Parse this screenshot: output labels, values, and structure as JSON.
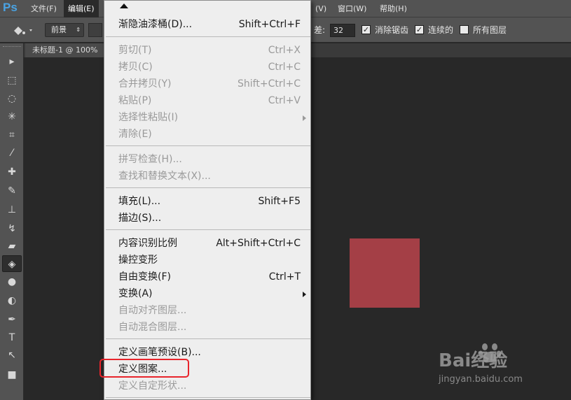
{
  "app": {
    "logo": "Ps"
  },
  "menubar": {
    "items": [
      {
        "label": "文件(F)"
      },
      {
        "label": "编辑(E)"
      },
      {
        "label": "(V)"
      },
      {
        "label": "窗口(W)"
      },
      {
        "label": "帮助(H)"
      }
    ],
    "active_index": 1
  },
  "options": {
    "fill_source": "前景",
    "tolerance_label": "差:",
    "tolerance_value": "32",
    "antialias_label": "消除锯齿",
    "antialias_checked": true,
    "contiguous_label": "连续的",
    "contiguous_checked": true,
    "all_layers_label": "所有图层",
    "all_layers_checked": false
  },
  "toolbox": {
    "tools": [
      {
        "name": "move-tool-icon",
        "glyph": "▸"
      },
      {
        "name": "marquee-tool-icon",
        "glyph": "⬚"
      },
      {
        "name": "lasso-tool-icon",
        "glyph": "◌"
      },
      {
        "name": "magic-wand-tool-icon",
        "glyph": "✳"
      },
      {
        "name": "crop-tool-icon",
        "glyph": "⌗"
      },
      {
        "name": "eyedropper-tool-icon",
        "glyph": "⁄"
      },
      {
        "name": "healing-brush-tool-icon",
        "glyph": "✚"
      },
      {
        "name": "brush-tool-icon",
        "glyph": "✎"
      },
      {
        "name": "stamp-tool-icon",
        "glyph": "⊥"
      },
      {
        "name": "history-brush-tool-icon",
        "glyph": "↯"
      },
      {
        "name": "eraser-tool-icon",
        "glyph": "▰"
      },
      {
        "name": "paint-bucket-tool-icon",
        "glyph": "◈"
      },
      {
        "name": "blur-tool-icon",
        "glyph": "●"
      },
      {
        "name": "dodge-tool-icon",
        "glyph": "◐"
      },
      {
        "name": "pen-tool-icon",
        "glyph": "✒"
      },
      {
        "name": "type-tool-icon",
        "glyph": "T"
      },
      {
        "name": "path-select-tool-icon",
        "glyph": "↖"
      },
      {
        "name": "shape-tool-icon",
        "glyph": "■"
      }
    ],
    "selected_index": 11
  },
  "document": {
    "tab_title": "未标题-1 @ 100%"
  },
  "canvas": {
    "shape_color": "#a43f46"
  },
  "edit_menu": {
    "items": [
      {
        "label": "渐隐油漆桶(D)...",
        "shortcut": "Shift+Ctrl+F",
        "disabled": false
      },
      {
        "label": "剪切(T)",
        "shortcut": "Ctrl+X",
        "disabled": true
      },
      {
        "label": "拷贝(C)",
        "shortcut": "Ctrl+C",
        "disabled": true
      },
      {
        "label": "合并拷贝(Y)",
        "shortcut": "Shift+Ctrl+C",
        "disabled": true
      },
      {
        "label": "粘贴(P)",
        "shortcut": "Ctrl+V",
        "disabled": true
      },
      {
        "label": "选择性粘贴(I)",
        "shortcut": "",
        "disabled": true,
        "submenu": true
      },
      {
        "label": "清除(E)",
        "shortcut": "",
        "disabled": true
      },
      {
        "label": "拼写检查(H)...",
        "shortcut": "",
        "disabled": true
      },
      {
        "label": "查找和替换文本(X)...",
        "shortcut": "",
        "disabled": true
      },
      {
        "label": "填充(L)...",
        "shortcut": "Shift+F5",
        "disabled": false
      },
      {
        "label": "描边(S)...",
        "shortcut": "",
        "disabled": false
      },
      {
        "label": "内容识别比例",
        "shortcut": "Alt+Shift+Ctrl+C",
        "disabled": false
      },
      {
        "label": "操控变形",
        "shortcut": "",
        "disabled": false
      },
      {
        "label": "自由变换(F)",
        "shortcut": "Ctrl+T",
        "disabled": false
      },
      {
        "label": "变换(A)",
        "shortcut": "",
        "disabled": false,
        "submenu": true
      },
      {
        "label": "自动对齐图层...",
        "shortcut": "",
        "disabled": true
      },
      {
        "label": "自动混合图层...",
        "shortcut": "",
        "disabled": true
      },
      {
        "label": "定义画笔预设(B)...",
        "shortcut": "",
        "disabled": false
      },
      {
        "label": "定义图案...",
        "shortcut": "",
        "disabled": false,
        "highlighted": true
      },
      {
        "label": "定义自定形状...",
        "shortcut": "",
        "disabled": true
      }
    ]
  },
  "watermark": {
    "brand": "Bai经验",
    "url": "jingyan.baidu.com"
  },
  "colors": {
    "highlight_outline": "#e8242b",
    "ui_panel": "#535353",
    "canvas_bg": "#282828"
  }
}
